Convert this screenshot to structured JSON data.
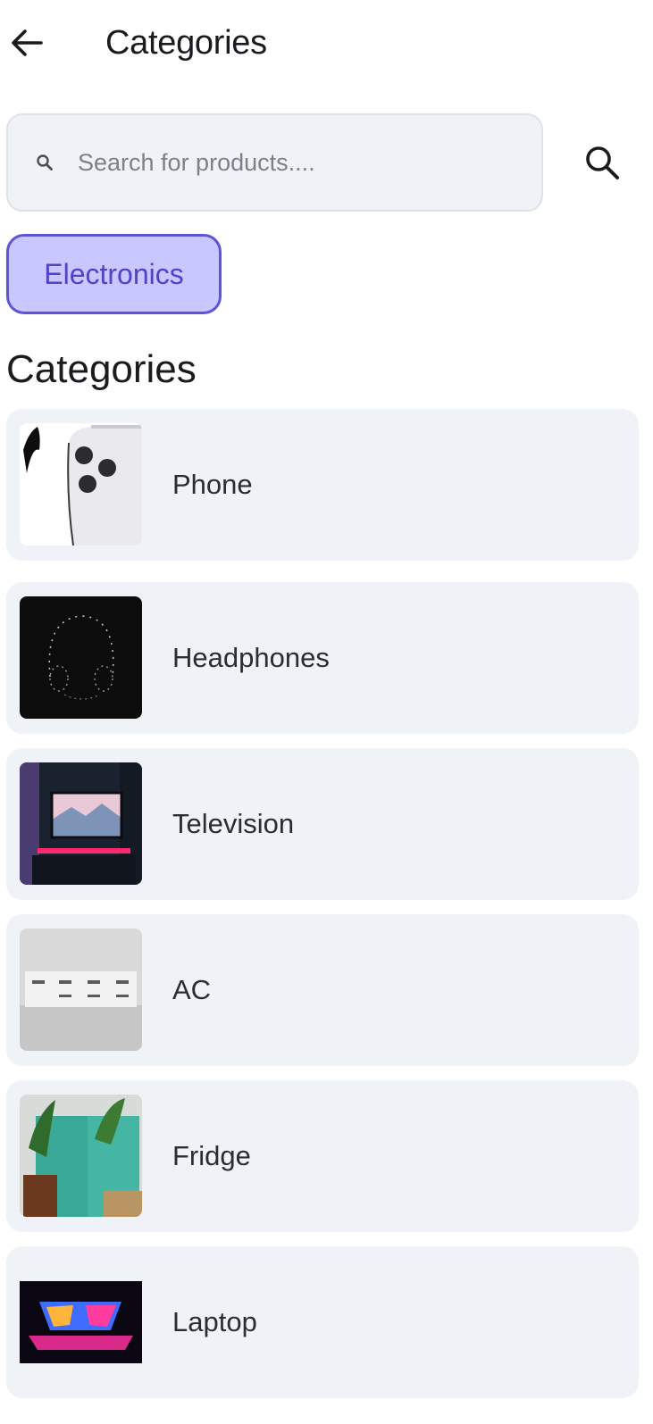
{
  "app_bar": {
    "title": "Categories",
    "back_icon": "arrow-left-icon"
  },
  "search": {
    "placeholder": "Search for products....",
    "value": "",
    "lead_icon": "search-icon",
    "action_icon": "search-icon"
  },
  "filter_chip": {
    "label": "Electronics",
    "selected": true
  },
  "section": {
    "title": "Categories"
  },
  "categories": [
    {
      "label": "Phone",
      "image": "phone-photo"
    },
    {
      "label": "Headphones",
      "image": "headphones-photo"
    },
    {
      "label": "Television",
      "image": "television-photo"
    },
    {
      "label": "AC",
      "image": "ac-photo"
    },
    {
      "label": "Fridge",
      "image": "fridge-photo"
    },
    {
      "label": "Laptop",
      "image": "laptop-photo"
    }
  ],
  "colors": {
    "card_bg": "#eff2f7",
    "chip_bg": "#c8c7ff",
    "chip_border": "#5d55d8",
    "chip_text": "#4d45c9"
  }
}
